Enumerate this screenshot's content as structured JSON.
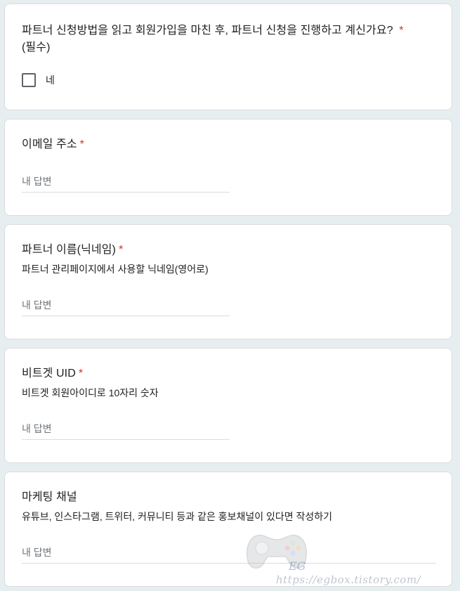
{
  "questions": [
    {
      "title": "파트너 신청방법을 읽고 회원가입을 마친 후, 파트너 신청을 진행하고 계신가요? *",
      "title_line2": "(필수)",
      "checkbox_label": "네"
    },
    {
      "title": "이메일 주소",
      "required_mark": "*",
      "placeholder": "내 답변"
    },
    {
      "title": "파트너 이름(닉네임)",
      "required_mark": "*",
      "description": "파트너 관리페이지에서 사용할 닉네임(영어로)",
      "placeholder": "내 답변"
    },
    {
      "title": "비트겟 UID",
      "required_mark": "*",
      "description": "비트겟 회원아이디로 10자리 숫자",
      "placeholder": "내 답변"
    },
    {
      "title": "마케팅 채널",
      "description": "유튜브, 인스타그램, 트위터, 커뮤니티 등과 같은 홍보채널이 있다면 작성하기",
      "placeholder": "내 답변"
    }
  ],
  "watermark": {
    "logo_text": "EG",
    "url": "https://egbox.tistory.com/"
  },
  "colors": {
    "background": "#e6eef0",
    "card": "#ffffff",
    "required": "#d93025",
    "placeholder": "#70757a"
  }
}
